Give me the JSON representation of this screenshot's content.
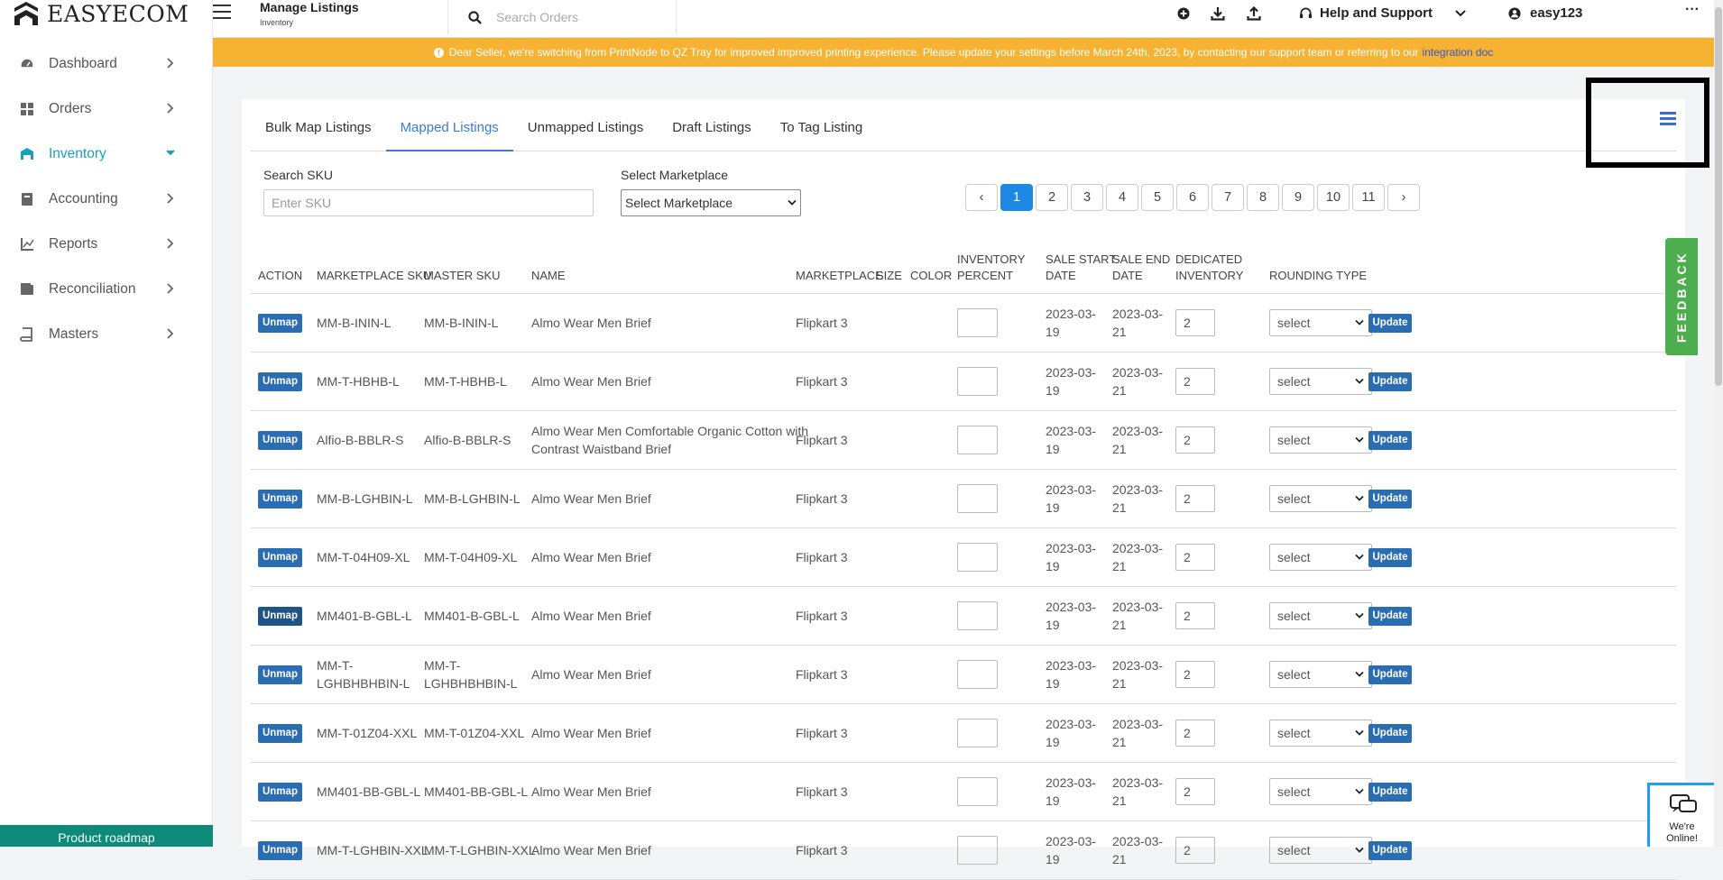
{
  "app": {
    "brand": "EASYECOM"
  },
  "sidebar": {
    "items": [
      {
        "label": "Dashboard",
        "icon": "dashboard-icon"
      },
      {
        "label": "Orders",
        "icon": "grid-icon"
      },
      {
        "label": "Inventory",
        "icon": "inventory-icon"
      },
      {
        "label": "Accounting",
        "icon": "ledger-icon"
      },
      {
        "label": "Reports",
        "icon": "chart-icon"
      },
      {
        "label": "Reconciliation",
        "icon": "wallet-icon"
      },
      {
        "label": "Masters",
        "icon": "book-icon"
      }
    ],
    "roadmap_label": "Product roadmap"
  },
  "header": {
    "title": "Manage Listings",
    "subtitle": "Inventory",
    "search_placeholder": "Search Orders",
    "help_label": "Help and Support",
    "user_label": "easy123",
    "more_label": "···"
  },
  "banner": {
    "text": "Dear Seller, we're switching from PrintNode to QZ Tray for improved improved printing experience. Please update your settings before March 24th, 2023, by contacting our support team or referring to our",
    "link": "integration doc"
  },
  "tabs": [
    {
      "label": "Bulk Map Listings"
    },
    {
      "label": "Mapped Listings"
    },
    {
      "label": "Unmapped Listings"
    },
    {
      "label": "Draft Listings"
    },
    {
      "label": "To Tag Listing"
    }
  ],
  "filters": {
    "sku_label": "Search SKU",
    "sku_placeholder": "Enter SKU",
    "marketplace_label": "Select Marketplace",
    "marketplace_value": "Select Marketplace"
  },
  "pagination": {
    "prev": "‹",
    "next": "›",
    "pages": [
      "1",
      "2",
      "3",
      "4",
      "5",
      "6",
      "7",
      "8",
      "9",
      "10",
      "11"
    ],
    "current": "1"
  },
  "table": {
    "headers": {
      "action": "ACTION",
      "marketplace_sku": "MARKETPLACE SKU",
      "master_sku": "MASTER SKU",
      "name": "NAME",
      "marketplace": "MARKETPLACE",
      "size": "SIZE",
      "color": "COLOR",
      "inventory_percent_1": "INVENTORY",
      "inventory_percent_2": "PERCENT",
      "sale_start_1": "SALE START",
      "sale_start_2": "DATE",
      "sale_end_1": "SALE END",
      "sale_end_2": "DATE",
      "dedicated_1": "DEDICATED",
      "dedicated_2": "INVENTORY",
      "rounding": "ROUNDING TYPE"
    },
    "unmap_label": "Unmap",
    "update_label": "Update",
    "select_label": "select",
    "rows": [
      {
        "msku": [
          "MM-B-ININ-L"
        ],
        "master": [
          "MM-B-ININ-L"
        ],
        "name": [
          "Almo Wear Men Brief"
        ],
        "marketplace": "Flipkart 3",
        "start": [
          "2023-03-",
          "19"
        ],
        "end": [
          "2023-03-",
          "21"
        ],
        "dedicated": "2"
      },
      {
        "msku": [
          "MM-T-HBHB-L"
        ],
        "master": [
          "MM-T-HBHB-L"
        ],
        "name": [
          "Almo Wear Men Brief"
        ],
        "marketplace": "Flipkart 3",
        "start": [
          "2023-03-",
          "19"
        ],
        "end": [
          "2023-03-",
          "21"
        ],
        "dedicated": "2"
      },
      {
        "msku": [
          "Alfio-B-BBLR-S"
        ],
        "master": [
          "Alfio-B-BBLR-S"
        ],
        "name": [
          "Almo Wear Men Comfortable Organic Cotton with",
          "Contrast Waistband Brief"
        ],
        "marketplace": "Flipkart 3",
        "start": [
          "2023-03-",
          "19"
        ],
        "end": [
          "2023-03-",
          "21"
        ],
        "dedicated": "2"
      },
      {
        "msku": [
          "MM-B-LGHBIN-L"
        ],
        "master": [
          "MM-B-LGHBIN-L"
        ],
        "name": [
          "Almo Wear Men Brief"
        ],
        "marketplace": "Flipkart 3",
        "start": [
          "2023-03-",
          "19"
        ],
        "end": [
          "2023-03-",
          "21"
        ],
        "dedicated": "2"
      },
      {
        "msku": [
          "MM-T-04H09-XL"
        ],
        "master": [
          "MM-T-04H09-XL"
        ],
        "name": [
          "Almo Wear Men Brief"
        ],
        "marketplace": "Flipkart 3",
        "start": [
          "2023-03-",
          "19"
        ],
        "end": [
          "2023-03-",
          "21"
        ],
        "dedicated": "2"
      },
      {
        "msku": [
          "MM401-B-GBL-L"
        ],
        "master": [
          "MM401-B-GBL-L"
        ],
        "name": [
          "Almo Wear Men Brief"
        ],
        "marketplace": "Flipkart 3",
        "start": [
          "2023-03-",
          "19"
        ],
        "end": [
          "2023-03-",
          "21"
        ],
        "dedicated": "2"
      },
      {
        "msku": [
          "MM-T-",
          "LGHBHBHBIN-L"
        ],
        "master": [
          "MM-T-",
          "LGHBHBHBIN-L"
        ],
        "name": [
          "Almo Wear Men Brief"
        ],
        "marketplace": "Flipkart 3",
        "start": [
          "2023-03-",
          "19"
        ],
        "end": [
          "2023-03-",
          "21"
        ],
        "dedicated": "2"
      },
      {
        "msku": [
          "MM-T-01Z04-XXL"
        ],
        "master": [
          "MM-T-01Z04-XXL"
        ],
        "name": [
          "Almo Wear Men Brief"
        ],
        "marketplace": "Flipkart 3",
        "start": [
          "2023-03-",
          "19"
        ],
        "end": [
          "2023-03-",
          "21"
        ],
        "dedicated": "2"
      },
      {
        "msku": [
          "MM401-BB-GBL-L"
        ],
        "master": [
          "MM401-BB-GBL-L"
        ],
        "name": [
          "Almo Wear Men Brief"
        ],
        "marketplace": "Flipkart 3",
        "start": [
          "2023-03-",
          "19"
        ],
        "end": [
          "2023-03-",
          "21"
        ],
        "dedicated": "2"
      },
      {
        "msku": [
          "MM-T-LGHBIN-XXL"
        ],
        "master": [
          "MM-T-LGHBIN-XXL"
        ],
        "name": [
          "Almo Wear Men Brief"
        ],
        "marketplace": "Flipkart 3",
        "start": [
          "2023-03-",
          "19"
        ],
        "end": [
          "2023-03-",
          "21"
        ],
        "dedicated": "2"
      }
    ]
  },
  "feedback_label": "FEEDBACK",
  "chat": {
    "line1": "We're",
    "line2": "Online!"
  },
  "colors": {
    "accent": "#17a2b8",
    "primary": "#2a6db3",
    "banner": "#f6b333",
    "feedback": "#4cae4c"
  }
}
